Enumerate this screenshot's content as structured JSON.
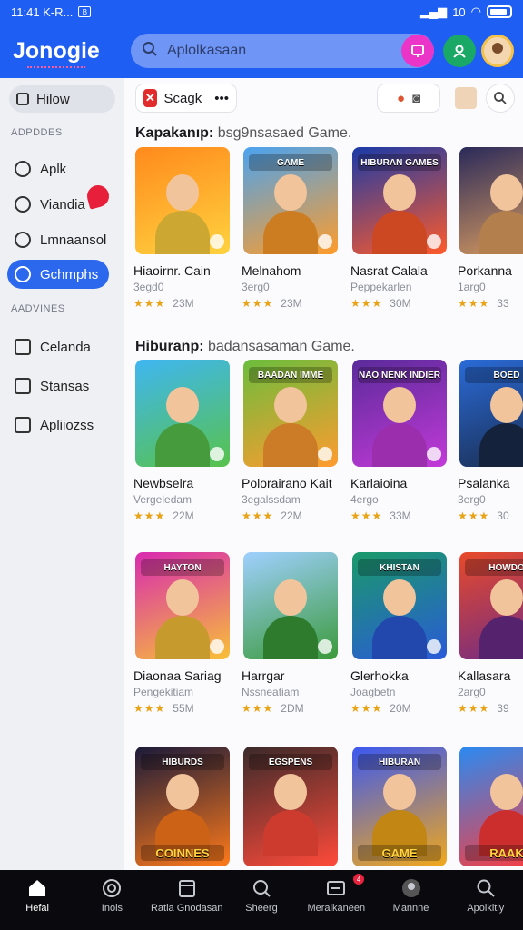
{
  "status_bar": {
    "time": "11:41 K-R...",
    "box_glyph": "B",
    "network": "10"
  },
  "app_bar": {
    "logo": "Jonogie",
    "search_placeholder": "Aplolkasaan"
  },
  "sidebar": {
    "top_button": "Hilow",
    "section1_title": "ADPDDES",
    "section1_items": [
      "Aplk",
      "Viandia",
      "Lmnaansol",
      "Gchmphs"
    ],
    "section2_title": "AADVINES",
    "section2_items": [
      "Celanda",
      "Stansas",
      "Apliiozss"
    ]
  },
  "main": {
    "chip_label": "Scagk",
    "chip_more": "•••",
    "section1_heading_bold": "Kapakanıp:",
    "section1_heading_rest": " bsg9nsasaed Game.",
    "section2_heading_bold": "Hiburanp:",
    "section2_heading_rest": " badansasaman Game.",
    "row1": [
      {
        "title": "Hiaoirnr. Cain",
        "sub": "3egd0",
        "stars": "★★★",
        "count": "23M"
      },
      {
        "title": "Melnahom",
        "sub": "3erg0",
        "stars": "★★★",
        "count": "23M"
      },
      {
        "title": "Nasrat Calala",
        "sub": "Peppekarlen",
        "stars": "★★★",
        "count": "30M"
      },
      {
        "title": "Porkanna",
        "sub": "1arg0",
        "stars": "★★★",
        "count": "33"
      }
    ],
    "row2": [
      {
        "title": "Newbselra",
        "sub": "Vergeledam",
        "stars": "★★★",
        "count": "22M"
      },
      {
        "title": "Polorairano Kait",
        "sub": "3egalssdam",
        "stars": "★★★",
        "count": "22M"
      },
      {
        "title": "Karlaioina",
        "sub": "4ergo",
        "stars": "★★★",
        "count": "33M"
      },
      {
        "title": "Psalanka",
        "sub": "3erg0",
        "stars": "★★★",
        "count": "30"
      }
    ],
    "row3": [
      {
        "title": "Diaonaa Sariag",
        "sub": "Pengekitiam",
        "stars": "★★★",
        "count": "55M"
      },
      {
        "title": "Harrgar",
        "sub": "Nssneatiam",
        "stars": "★★★",
        "count": "2DM"
      },
      {
        "title": "Glerhokka",
        "sub": "Joagbetn",
        "stars": "★★★",
        "count": "20M"
      },
      {
        "title": "Kallasara",
        "sub": "2arg0",
        "stars": "★★★",
        "count": "39"
      }
    ],
    "row1_banners": [
      "",
      "GAME",
      "HIBURAN GAMES",
      ""
    ],
    "row2_banners": [
      "",
      "BAADAN IMME",
      "NAO NENK INDIER",
      "BOED"
    ],
    "row3_banners": [
      "HAYTON",
      "",
      "KHISTAN",
      "HOWDO"
    ],
    "row4_banners": [
      "HIBURDS",
      "EGSPENS",
      "HIBURAN",
      ""
    ],
    "row4_bottom": [
      "COINNES",
      "",
      "GAME",
      "RAAK"
    ]
  },
  "bottom_nav": [
    {
      "label": "Hefal"
    },
    {
      "label": "Inols"
    },
    {
      "label": "Ratia Gnodasan"
    },
    {
      "label": "Sheerg"
    },
    {
      "label": "Meralkaneen",
      "badge": "4"
    },
    {
      "label": "Mannne"
    },
    {
      "label": "Apolkitiy"
    }
  ],
  "colors": {
    "primary": "#1f5ef2",
    "active_nav": "#2c68ee",
    "star": "#e8a317"
  }
}
